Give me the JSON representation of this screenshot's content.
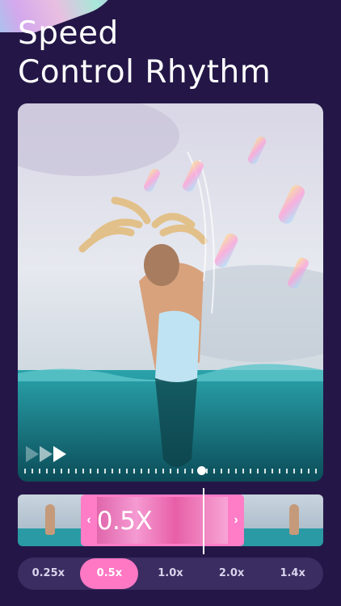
{
  "headline": {
    "line1": "Speed",
    "line2": "Control Rhythm"
  },
  "player": {
    "speed_icon": "fast-forward-icon",
    "progress": 0.61
  },
  "timeline": {
    "speed_label": "0.5X",
    "left_handle": "‹",
    "right_handle": "›"
  },
  "speed_options": [
    {
      "label": "0.25x",
      "selected": false
    },
    {
      "label": "0.5x",
      "selected": true
    },
    {
      "label": "1.0x",
      "selected": false
    },
    {
      "label": "2.0x",
      "selected": false
    },
    {
      "label": "1.4x",
      "selected": false
    }
  ],
  "colors": {
    "background": "#241747",
    "accent_pink": "#ff78c4",
    "bar_background": "#3b2c61"
  }
}
